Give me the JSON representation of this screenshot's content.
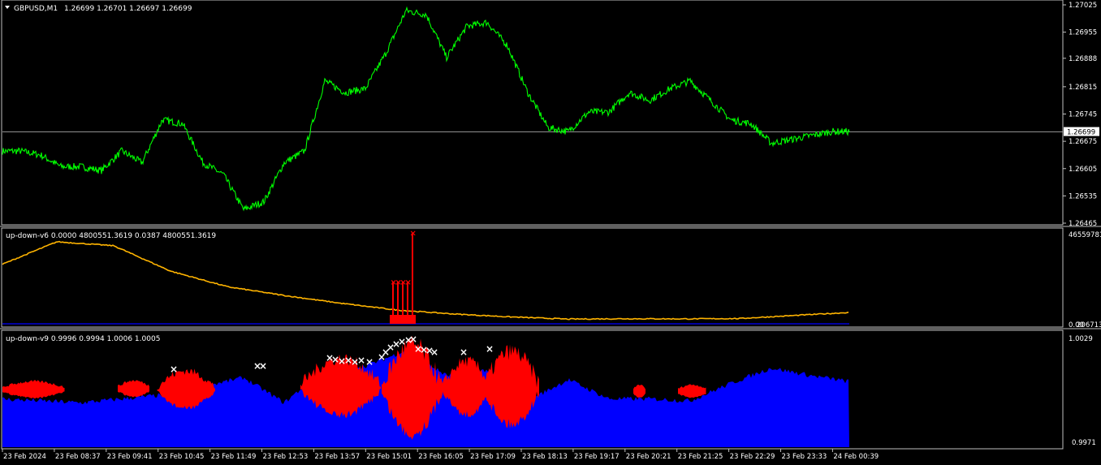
{
  "main": {
    "symbol_label": "GBPUSD,M1",
    "ohlc": "1.26699 1.26701 1.26697 1.26699",
    "current_price": "1.26699",
    "price_axis": [
      "1.27025",
      "1.26955",
      "1.26888",
      "1.26815",
      "1.26745",
      "1.26675",
      "1.26605",
      "1.26535",
      "1.26465"
    ]
  },
  "ind1": {
    "title": "up-down-v6 0.0000 4800551.3619 0.0387 4800551.3619",
    "axis_top": "46559781",
    "axis_bottom": "0.00",
    "axis_bottom2": "2067132."
  },
  "ind2": {
    "title": "up-down-v9 0.9996 0.9994 1.0006 1.0005",
    "axis_top": "1.0029",
    "axis_bottom": "0.9971"
  },
  "time_axis": [
    "23 Feb 2024",
    "23 Feb 08:37",
    "23 Feb 09:41",
    "23 Feb 10:45",
    "23 Feb 11:49",
    "23 Feb 12:53",
    "23 Feb 13:57",
    "23 Feb 15:01",
    "23 Feb 16:05",
    "23 Feb 17:09",
    "23 Feb 18:13",
    "23 Feb 19:17",
    "23 Feb 20:21",
    "23 Feb 21:25",
    "23 Feb 22:29",
    "23 Feb 23:33",
    "24 Feb 00:39"
  ],
  "colors": {
    "price_line": "#00ff00",
    "ma_line": "#ffb400",
    "volume_bar": "#ff0000",
    "up_area": "#0000ff",
    "down_area": "#ff0000",
    "marker_top": "#ffffff",
    "grid_line": "#c0c0c0",
    "baseline": "#0000ff"
  },
  "chart_data": [
    {
      "type": "line",
      "series": [
        {
          "name": "GBPUSD,M1",
          "x": [
            0,
            25,
            50,
            75,
            100,
            125,
            150,
            175,
            200,
            225,
            250,
            275,
            300,
            325,
            350,
            375,
            400,
            425,
            450,
            475,
            500,
            525,
            550,
            575,
            600,
            625,
            650,
            675,
            700,
            725,
            750,
            775,
            800,
            825,
            850,
            875,
            900,
            925,
            950,
            975,
            1000,
            1025,
            1045
          ],
          "values": [
            1.2665,
            1.2665,
            1.2664,
            1.2661,
            1.2661,
            1.266,
            1.2665,
            1.2662,
            1.2673,
            1.2672,
            1.2662,
            1.2659,
            1.265,
            1.2652,
            1.2662,
            1.2665,
            1.2683,
            1.268,
            1.2681,
            1.269,
            1.2701,
            1.27,
            1.2689,
            1.2697,
            1.2698,
            1.2692,
            1.268,
            1.2671,
            1.267,
            1.2675,
            1.2675,
            1.268,
            1.2678,
            1.2681,
            1.2683,
            1.2678,
            1.2673,
            1.2672,
            1.2667,
            1.2668,
            1.2669,
            1.267,
            1.267
          ]
        }
      ],
      "ylim": [
        1.26465,
        1.27025
      ]
    },
    {
      "type": "line",
      "series": [
        {
          "name": "up-down-v6",
          "x": [
            0,
            70,
            140,
            210,
            280,
            350,
            420,
            490,
            560,
            630,
            700,
            770,
            840,
            910,
            980,
            1045
          ],
          "values": [
            30000000,
            42000000,
            40000000,
            27000000,
            19000000,
            14500000,
            10500000,
            7000000,
            5000000,
            3500000,
            2400000,
            2600000,
            2500000,
            2700000,
            4300000,
            5800000
          ]
        }
      ],
      "bars": {
        "x": [
          484,
          490,
          496,
          502,
          508
        ],
        "values": [
          21500000,
          21500000,
          21500000,
          21500000,
          46559781
        ]
      },
      "ylim": [
        0,
        46559781
      ]
    },
    {
      "type": "area",
      "series": [
        {
          "name": "up-down-v9",
          "x": [
            0,
            100,
            200,
            300,
            350,
            400,
            450,
            500,
            550,
            600,
            650,
            700,
            750,
            800,
            850,
            900,
            950,
            1000,
            1045
          ],
          "values": [
            0.9996,
            0.9994,
            0.9998,
            1.0007,
            0.9994,
            1.0011,
            1.0013,
            1.0021,
            1.0008,
            1.0011,
            0.9995,
            1.0006,
            0.9996,
            0.9996,
            0.9995,
            1.0004,
            1.0012,
            1.0008,
            1.0005
          ]
        }
      ],
      "ylim": [
        0.9971,
        1.0029
      ]
    }
  ]
}
